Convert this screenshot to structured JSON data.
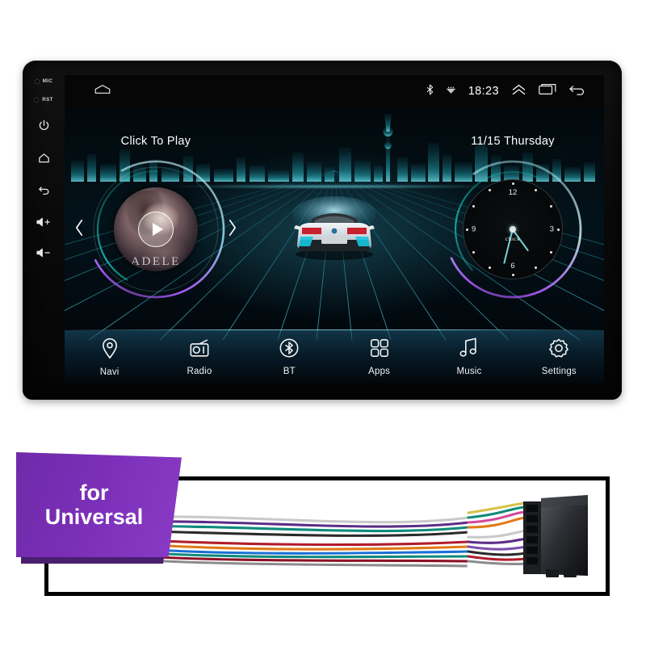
{
  "product": {
    "badge_line1": "for",
    "badge_line2": "Universal"
  },
  "device": {
    "bezel": {
      "mic_label": "MIC",
      "rst_label": "RST",
      "buttons": [
        {
          "name": "power-icon",
          "label": "Power"
        },
        {
          "name": "home-icon",
          "label": "Home"
        },
        {
          "name": "back-icon",
          "label": "Back"
        },
        {
          "name": "volume-up-icon",
          "label": "Vol +"
        },
        {
          "name": "volume-down-icon",
          "label": "Vol -"
        }
      ]
    },
    "statusbar": {
      "home_icon": "home-icon",
      "bluetooth_icon": "bluetooth-icon",
      "signal_icon": "signal-icon",
      "time": "18:23",
      "chevron_up_icon": "chevron-up-icon",
      "recents_icon": "recent-apps-icon",
      "back_icon": "back-arrow-icon"
    },
    "widgets": {
      "music": {
        "title": "Click To Play",
        "artist": "ADELE",
        "play_icon": "play-icon",
        "prev_icon": "chevron-left-icon",
        "next_icon": "chevron-right-icon"
      },
      "clock": {
        "title": "11/15  Thursday",
        "brand": "clock",
        "numerals": [
          "12",
          "3",
          "6",
          "9"
        ]
      }
    },
    "dock": [
      {
        "label": "Navi",
        "icon": "location-pin-icon"
      },
      {
        "label": "Radio",
        "icon": "radio-icon"
      },
      {
        "label": "BT",
        "icon": "bluetooth-icon"
      },
      {
        "label": "Apps",
        "icon": "apps-grid-icon"
      },
      {
        "label": "Music",
        "icon": "music-note-icon"
      },
      {
        "label": "Settings",
        "icon": "gear-icon"
      }
    ]
  },
  "colors": {
    "accent_teal": "#6fd6d6",
    "accent_purple": "#7b2fb8",
    "screen_bg": "#02080c",
    "dock_glow": "#8cf0ff"
  },
  "harness": {
    "left_connector": "connector-block-left",
    "right_connector": "connector-block-right",
    "wire_colors": [
      "#ffffff",
      "#6f3f9e",
      "#0f8a7a",
      "#b01d2a",
      "#e07a18",
      "#1a6fd4",
      "#d6c24a",
      "#d14a9a",
      "#2f2f2f",
      "#8c8c8c"
    ]
  }
}
